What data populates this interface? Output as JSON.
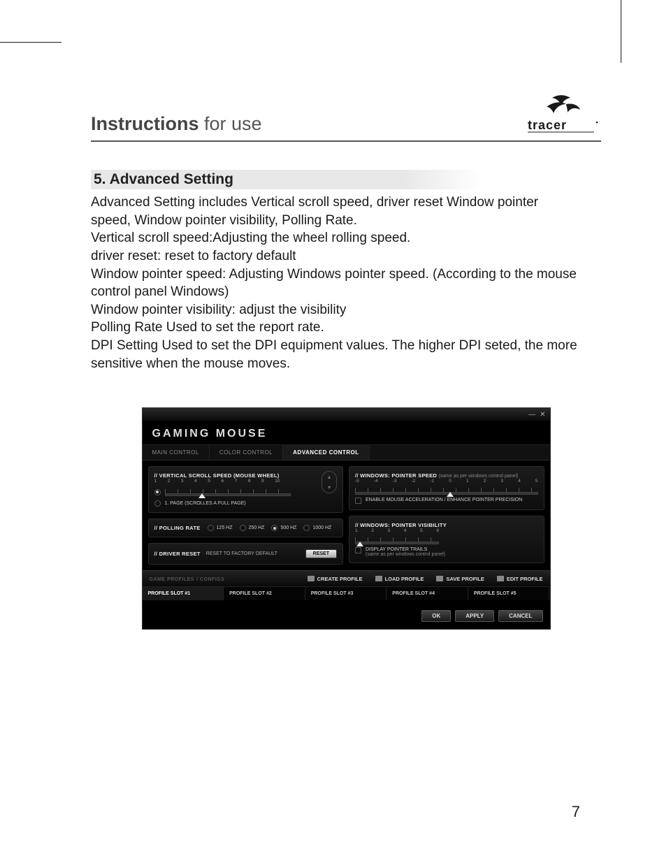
{
  "page": {
    "heading_bold": "Instructions",
    "heading_light": " for use",
    "brand": "tracer",
    "page_number": "7"
  },
  "section": {
    "title": "5. Advanced Setting",
    "p1": "Advanced Setting includes Vertical scroll speed, driver reset Window pointer speed, Window pointer visibility, Polling Rate.",
    "p2": "Vertical scroll speed:Adjusting the wheel rolling speed.",
    "p3": "driver reset: reset to factory default",
    "p4": "Window pointer speed: Adjusting Windows pointer speed. (According to the mouse control panel Windows)",
    "p5": "Window pointer visibility: adjust the visibility",
    "p6": "Polling Rate Used to set the report rate.",
    "p7": "DPI Setting Used to set the DPI equipment values. The higher DPI seted, the more sensitive when the mouse moves."
  },
  "app": {
    "logo": "GAMING MOUSE",
    "tabs": {
      "main": "MAIN CONTROL",
      "color": "COLOR CONTROL",
      "advanced": "ADVANCED CONTROL"
    },
    "vscroll": {
      "title": "// VERTICAL SCROLL SPEED (MOUSE WHEEL)",
      "ticks": [
        "1",
        "2",
        "3",
        "4",
        "5",
        "6",
        "7",
        "8",
        "9",
        "10"
      ],
      "opt_full_page": "1. PAGE (SCROLLES A FULL PAGE)"
    },
    "polling": {
      "title": "// POLLING RATE",
      "opts": [
        "125 HZ",
        "250 HZ",
        "500 HZ",
        "1000 HZ"
      ]
    },
    "driver_reset": {
      "title": "// DRIVER RESET",
      "label": "RESET TO FACTORY DEFAULT",
      "button": "RESET"
    },
    "pointer_speed": {
      "title": "// WINDOWS: POINTER SPEED",
      "sub": "(same as per windows control panel)",
      "ticks": [
        "-5",
        "-4",
        "-3",
        "-2",
        "-1",
        "0",
        "1",
        "2",
        "3",
        "4",
        "5"
      ],
      "check": "ENABLE MOUSE ACCELERATION / ENHANCE POINTER PRECISION"
    },
    "pointer_vis": {
      "title": "// WINDOWS: POINTER VISIBILITY",
      "ticks": [
        "1",
        "2",
        "3",
        "4",
        "5",
        "6"
      ],
      "check": "DISPLAY POINTER TRAILS",
      "sub": "(same as per windows control panel)"
    },
    "profiles": {
      "title": "GAME PROFILES",
      "sub": "/ CONFIGS",
      "create": "CREATE PROFILE",
      "load": "LOAD PROFILE",
      "save": "SAVE PROFILE",
      "edit": "EDIT PROFILE",
      "slots": [
        "PROFILE SLOT #1",
        "PROFILE SLOT #2",
        "PROFILE SLOT #3",
        "PROFILE SLOT #4",
        "PROFILE SLOT #5"
      ]
    },
    "actions": {
      "ok": "OK",
      "apply": "APPLY",
      "cancel": "CANCEL"
    }
  }
}
